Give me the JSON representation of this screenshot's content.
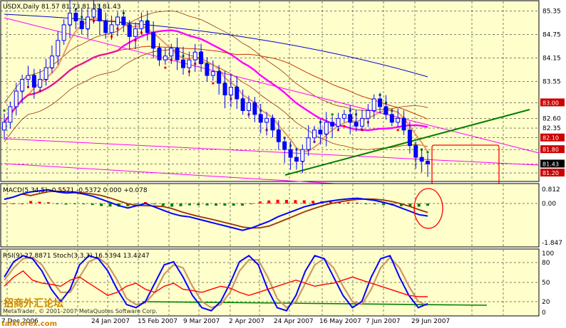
{
  "colors": {
    "background": "#ffffcc",
    "grid": "#000000",
    "bull_candle": "#0000ff",
    "bear_candle": "#0000ff",
    "psar": "#008000",
    "psar_red": "#ff0000",
    "ma_short": "#ff00ff",
    "ma_long": "#0000cc",
    "bollinger": "#993300",
    "trendline": "#008000",
    "channel": "#ff00ff",
    "highlight": "#ff0000",
    "macd_main": "#0000ff",
    "macd_signal": "#993300",
    "hist_pos": "#ff0000",
    "hist_neg": "#008000",
    "rsi": "#ff0000",
    "stoch_k": "#0000ff",
    "stoch_d": "#cc9966",
    "level_line": "#008000",
    "price_box": "#000000",
    "price_box_red": "#cc0000"
  },
  "main": {
    "header": "USDX,Daily  81.57 81.73 81.33 81.43",
    "levels": [
      "85.35",
      "84.75",
      "84.15",
      "83.55",
      "83.00",
      "82.60",
      "82.35",
      "82.10",
      "81.80",
      "81.43",
      "81.20"
    ],
    "current_price": "81.43"
  },
  "macd": {
    "header": "MACD(5,34,5) -0.5571 -0.5372 0.000 +0.078",
    "levels": [
      "0.812",
      "0.00",
      "-1.847"
    ]
  },
  "rsi": {
    "header": "RSI(9) 27.8871  Stoch(3,3,3) 16.5394 13.4247",
    "levels": [
      "100",
      "80",
      "50",
      "20",
      "0"
    ]
  },
  "watermark": {
    "copyright": "MetaTrader, © 2001-2007 MetaQuotes Software Corp.",
    "site_cn": "招商外汇论坛",
    "site_url": "talkforex.com"
  },
  "xaxis": [
    "7 Dec 2006",
    "24 Jan 2007",
    "15 Feb 2007",
    "9 Mar 2007",
    "2 Apr 2007",
    "24 Apr 2007",
    "16 May 2007",
    "7 Jun 2007",
    "29 Jun 2007"
  ],
  "chart_data": {
    "type": "candlestick",
    "symbol": "USDX",
    "timeframe": "Daily",
    "ohlc": [
      81.57,
      81.73,
      81.33,
      81.43
    ],
    "price_close": [
      82.5,
      82.9,
      83.3,
      83.6,
      83.7,
      83.4,
      83.6,
      83.9,
      84.2,
      84.6,
      85.0,
      85.3,
      85.1,
      84.9,
      85.2,
      85.4,
      85.1,
      84.8,
      85.0,
      85.2,
      85.0,
      84.7,
      84.9,
      85.1,
      84.8,
      84.4,
      84.1,
      84.2,
      84.4,
      84.1,
      83.9,
      84.1,
      84.3,
      84.0,
      83.7,
      83.8,
      83.5,
      83.2,
      83.4,
      83.1,
      82.8,
      83.0,
      82.7,
      82.5,
      82.6,
      82.3,
      82.0,
      81.8,
      81.6,
      81.5,
      81.8,
      82.1,
      82.3,
      82.2,
      82.5,
      82.4,
      82.6,
      82.7,
      82.5,
      82.4,
      82.6,
      82.8,
      83.1,
      82.9,
      82.7,
      82.5,
      82.6,
      82.3,
      81.9,
      81.6,
      81.5,
      81.43
    ],
    "macd_main": [
      0.2,
      0.3,
      0.45,
      0.55,
      0.6,
      0.65,
      0.55,
      0.5,
      0.52,
      0.45,
      0.35,
      0.2,
      0.05,
      -0.1,
      -0.2,
      -0.1,
      0.0,
      -0.15,
      -0.3,
      -0.45,
      -0.55,
      -0.6,
      -0.7,
      -0.8,
      -0.9,
      -1.0,
      -1.1,
      -1.2,
      -1.1,
      -0.95,
      -0.8,
      -0.6,
      -0.45,
      -0.3,
      -0.15,
      -0.05,
      0.05,
      0.12,
      0.18,
      0.22,
      0.25,
      0.2,
      0.15,
      0.05,
      -0.05,
      -0.2,
      -0.35,
      -0.5,
      -0.56
    ],
    "rsi": [
      45,
      60,
      70,
      55,
      50,
      48,
      45,
      55,
      60,
      50,
      40,
      30,
      35,
      45,
      50,
      40,
      35,
      45,
      50,
      40,
      38,
      35,
      40,
      45,
      42,
      35,
      30,
      35,
      40,
      45,
      50,
      55,
      50,
      45,
      48,
      50,
      55,
      60,
      55,
      50,
      45,
      40,
      35,
      30,
      28,
      27.9
    ],
    "stoch_k": [
      60,
      85,
      95,
      90,
      70,
      40,
      20,
      40,
      80,
      95,
      90,
      70,
      40,
      15,
      10,
      20,
      50,
      80,
      85,
      60,
      30,
      10,
      5,
      20,
      50,
      85,
      95,
      80,
      40,
      10,
      5,
      30,
      70,
      95,
      90,
      60,
      30,
      10,
      20,
      60,
      90,
      95,
      60,
      30,
      10,
      16.5
    ],
    "stoch_d": [
      55,
      75,
      90,
      92,
      80,
      55,
      35,
      35,
      60,
      85,
      92,
      80,
      55,
      25,
      15,
      18,
      35,
      65,
      80,
      75,
      45,
      20,
      10,
      15,
      35,
      70,
      88,
      88,
      60,
      25,
      10,
      20,
      50,
      80,
      90,
      75,
      45,
      20,
      15,
      40,
      75,
      92,
      75,
      45,
      20,
      13.4
    ]
  }
}
